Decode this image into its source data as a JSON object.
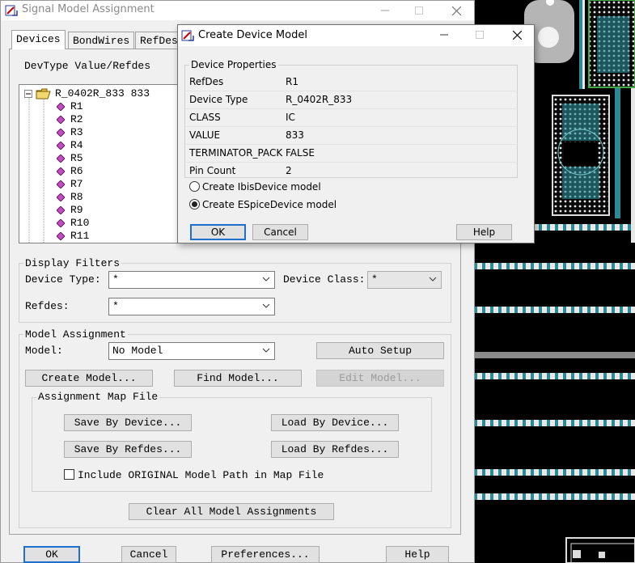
{
  "main_window": {
    "title": "Signal Model Assignment",
    "tabs": [
      "Devices",
      "BondWires",
      "RefDes"
    ],
    "devtype_label": "DevType Value/Refdes",
    "tree": {
      "root": "R_0402R_833 833",
      "children": [
        "R1",
        "R2",
        "R3",
        "R4",
        "R5",
        "R6",
        "R7",
        "R8",
        "R9",
        "R10",
        "R11"
      ]
    },
    "display_filters": {
      "title": "Display Filters",
      "device_type_label": "Device Type:",
      "device_type_value": "*",
      "device_class_label": "Device Class:",
      "device_class_value": "*",
      "refdes_label": "Refdes:",
      "refdes_value": "*"
    },
    "model_assignment": {
      "title": "Model Assignment",
      "model_label": "Model:",
      "model_value": "No Model",
      "auto_setup": "Auto Setup",
      "create_model": "Create Model...",
      "find_model": "Find Model...",
      "edit_model": "Edit Model..."
    },
    "map_file": {
      "title": "Assignment Map File",
      "save_by_device": "Save By Device...",
      "load_by_device": "Load By Device...",
      "save_by_refdes": "Save By Refdes...",
      "load_by_refdes": "Load By Refdes...",
      "include_checkbox": "Include ORIGINAL Model Path in Map File"
    },
    "clear_all": "Clear All Model Assignments",
    "footer": {
      "ok": "OK",
      "cancel": "Cancel",
      "preferences": "Preferences...",
      "help": "Help"
    }
  },
  "create_device_model": {
    "title": "Create Device Model",
    "group_title": "Device Properties",
    "properties": [
      {
        "key": "RefDes",
        "value": "R1"
      },
      {
        "key": "Device Type",
        "value": "R_0402R_833"
      },
      {
        "key": "CLASS",
        "value": "IC"
      },
      {
        "key": "VALUE",
        "value": "833"
      },
      {
        "key": "TERMINATOR_PACK",
        "value": "FALSE"
      },
      {
        "key": "Pin Count",
        "value": "2"
      }
    ],
    "radio_ibis": "Create IbisDevice model",
    "radio_espice": "Create ESpiceDevice model",
    "selected_radio": "Create ESpiceDevice model",
    "ok": "OK",
    "cancel": "Cancel",
    "help": "Help"
  },
  "colors": {
    "pcb_background": "#000000",
    "trace_teal": "#2a8a96",
    "pad_white": "#e8e8e8",
    "accent_blue": "#1f6fd0"
  }
}
